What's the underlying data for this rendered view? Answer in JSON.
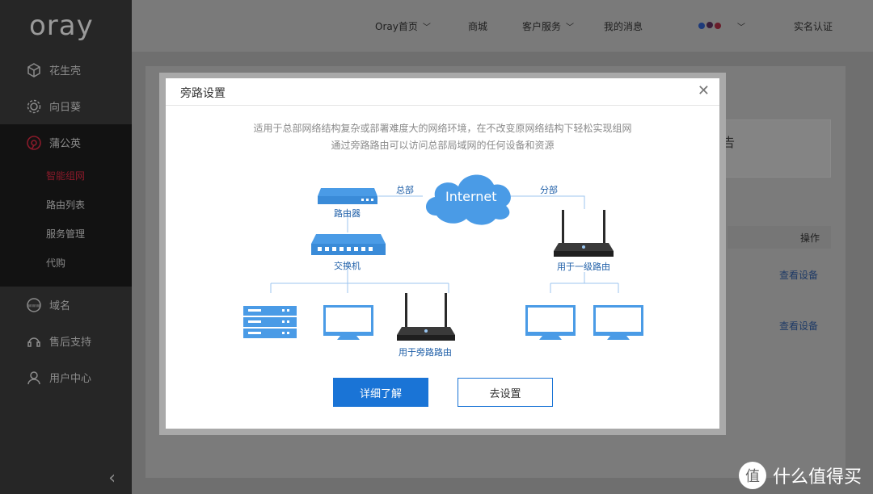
{
  "logo": "oray",
  "sidebar": {
    "items": [
      {
        "label": "花生壳"
      },
      {
        "label": "向日葵"
      },
      {
        "label": "蒲公英"
      },
      {
        "label": "域名"
      },
      {
        "label": "售后支持"
      },
      {
        "label": "用户中心"
      }
    ],
    "subitems": [
      {
        "label": "智能组网"
      },
      {
        "label": "路由列表"
      },
      {
        "label": "服务管理"
      },
      {
        "label": "代购"
      }
    ]
  },
  "topnav": {
    "home": "Oray首页",
    "mall": "商城",
    "service": "客户服务",
    "messages": "我的消息",
    "verify": "实名认证"
  },
  "background": {
    "ad_text": "公告",
    "table_header_action": "操作",
    "row_action_1": "查看设备",
    "row_action_2": "查看设备"
  },
  "dialog": {
    "title": "旁路设置",
    "desc_line1": "适用于总部网络结构复杂或部署难度大的网络环境，在不改变原网络结构下轻松实现组网",
    "desc_line2": "通过旁路路由可以访问总部局域网的任何设备和资源",
    "primary_button": "详细了解",
    "secondary_button": "去设置",
    "diagram": {
      "internet": "Internet",
      "hq_label": "总部",
      "branch_label": "分部",
      "router": "路由器",
      "switch": "交换机",
      "bypass_router": "用于旁路路由",
      "first_router": "用于一级路由"
    }
  },
  "watermark": "什么值得买",
  "colors": {
    "primary": "#1a74d6",
    "device_blue": "#4a9be6",
    "sidebar_bg": "#262626"
  }
}
